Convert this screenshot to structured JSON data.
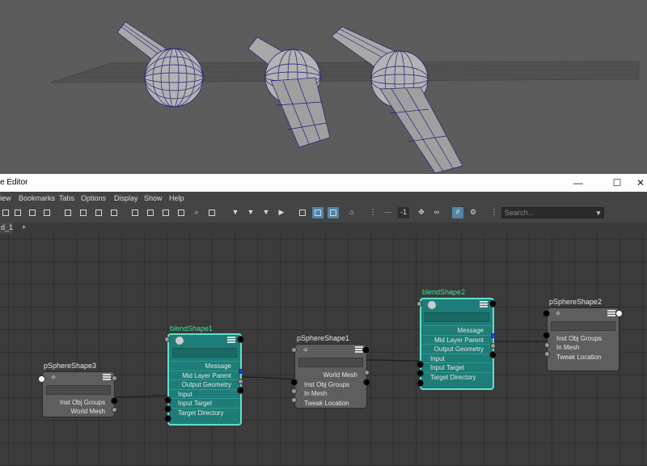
{
  "window": {
    "title": "e Editor",
    "minimize": "—",
    "maximize": "☐",
    "close": "✕"
  },
  "menu": [
    "iew",
    "Bookmarks",
    "Tabs",
    "Options",
    "Display",
    "Show",
    "Help"
  ],
  "toolbar": {
    "search_placeholder": "Search...",
    "counter": "-1"
  },
  "tabs": {
    "active": "d_1",
    "add": "+"
  },
  "nodes": {
    "pSphereShape3": {
      "label": "pSphereShape3",
      "rows": [
        "Inst Obj Groups",
        "World Mesh"
      ]
    },
    "blendShape1": {
      "label": "blendShape1",
      "rows": [
        "Message",
        "Mid Layer Parent",
        "Output Geometry",
        "Input",
        "Input Target",
        "Target Directory"
      ]
    },
    "pSphereShape1": {
      "label": "pSphereShape1",
      "rows": [
        "World Mesh",
        "Inst Obj Groups",
        "In Mesh",
        "Tweak Location"
      ]
    },
    "blendShape2": {
      "label": "blendShape2",
      "rows": [
        "Message",
        "Mid Layer Parent",
        "Output Geometry",
        "Input",
        "Input Target",
        "Target Directory"
      ]
    },
    "pSphereShape2": {
      "label": "pSphereShape2",
      "rows": [
        "Inst Obj Groups",
        "In Mesh",
        "Tweak Location"
      ]
    }
  },
  "colors": {
    "blend_node": "#1e7d78",
    "blend_border": "#5fe0cc",
    "blend_label": "#41e09e",
    "shape_node": "#5e5e5e",
    "viewport_bg": "#5c5c5c",
    "wire_blue": "#1d1d7a"
  }
}
